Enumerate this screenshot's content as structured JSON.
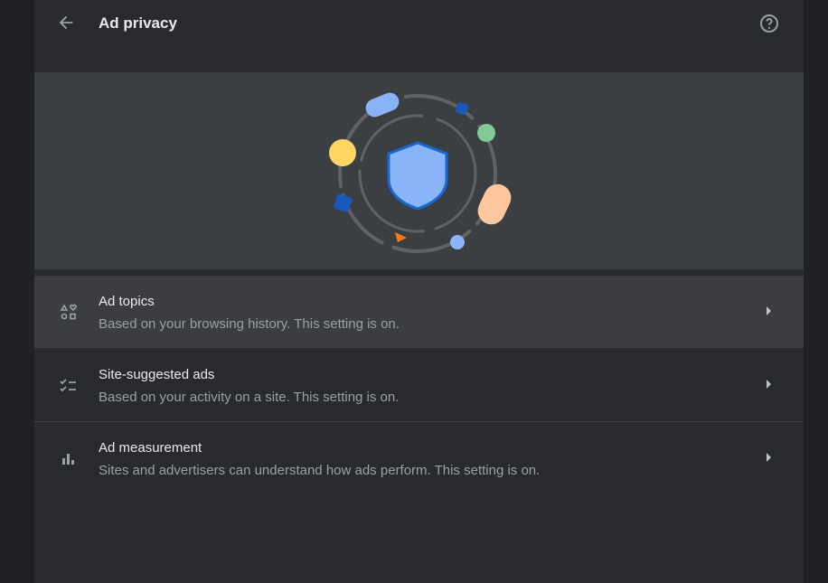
{
  "header": {
    "title": "Ad privacy",
    "back_icon": "arrow-back-icon",
    "help_icon": "help-circle-icon"
  },
  "banner": {
    "illustration": "shield-orbit",
    "colors": {
      "shield": "#8ab4f8",
      "shield_border": "#1967d2",
      "yellow": "#fdd663",
      "green": "#81c995",
      "peach": "#fcc934",
      "orange": "#fa7b17",
      "dark_blue": "#185abc"
    }
  },
  "items": [
    {
      "title": "Ad topics",
      "subtitle": "Based on your browsing history. This setting is on.",
      "icon": "ad-topics-shapes-icon"
    },
    {
      "title": "Site-suggested ads",
      "subtitle": "Based on your activity on a site. This setting is on.",
      "icon": "checklist-icon"
    },
    {
      "title": "Ad measurement",
      "subtitle": "Sites and advertisers can understand how ads perform. This setting is on.",
      "icon": "bar-chart-icon"
    }
  ]
}
